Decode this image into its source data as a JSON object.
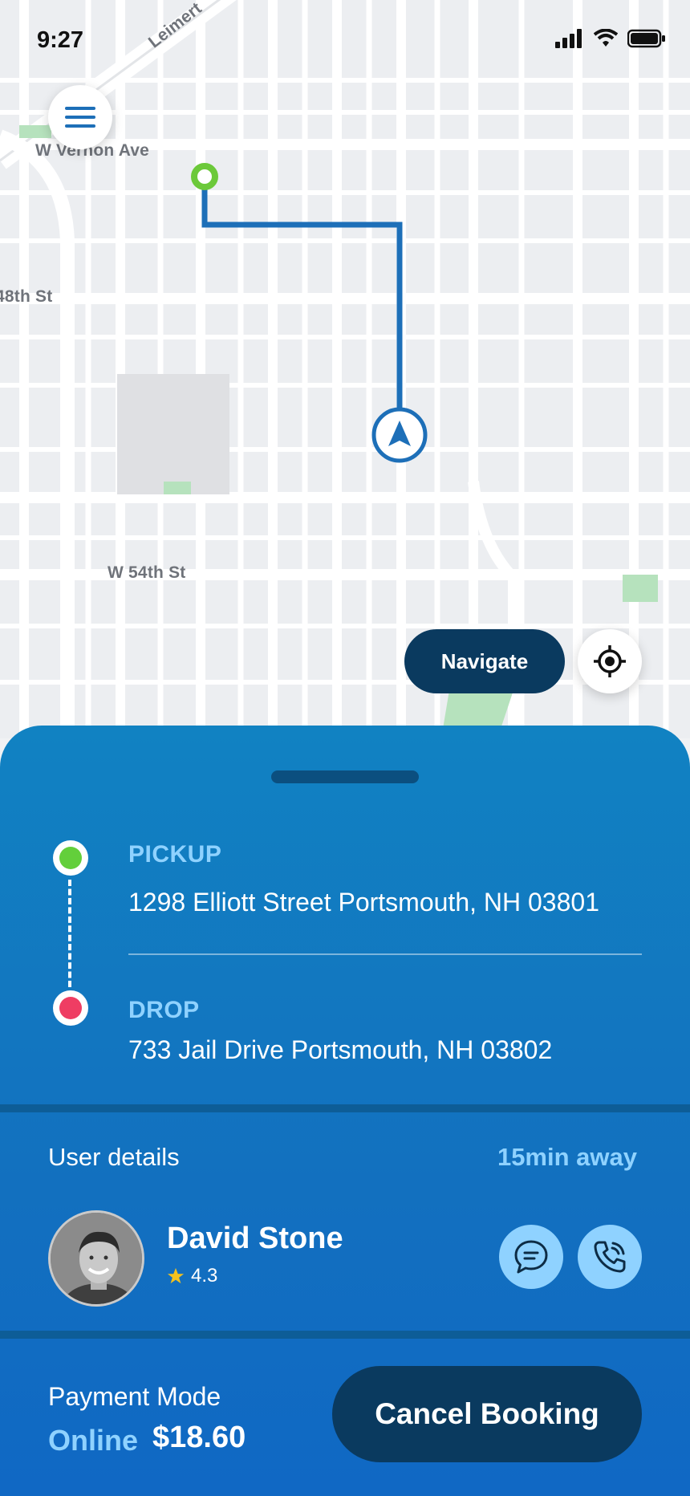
{
  "status_bar": {
    "time": "9:27"
  },
  "map": {
    "street_labels": {
      "leimert": "Leimert",
      "vernon": "W Vernon Ave",
      "st48": "48th St",
      "st54": "W 54th St"
    },
    "route_color": "#1d6fb8",
    "pickup_color": "#6cc93a"
  },
  "buttons": {
    "menu_icon": "hamburger-icon",
    "navigate_label": "Navigate",
    "locate_icon": "crosshair-icon"
  },
  "trip": {
    "pickup_label": "PICKUP",
    "pickup_address": "1298 Elliott Street Portsmouth, NH 03801",
    "drop_label": "DROP",
    "drop_address": "733 Jail Drive Portsmouth, NH 03802"
  },
  "user": {
    "section_title": "User details",
    "eta": "15min away",
    "name": "David Stone",
    "rating": "4.3",
    "chat_icon": "chat-icon",
    "call_icon": "phone-icon"
  },
  "payment": {
    "title": "Payment Mode",
    "mode": "Online",
    "amount": "$18.60",
    "cancel_label": "Cancel Booking"
  },
  "colors": {
    "sheet": "#1277bf",
    "dark_button": "#0a3a5f",
    "accent_light": "#8fd2ff",
    "pickup_dot": "#63cf3b",
    "drop_dot": "#ef3d63"
  }
}
